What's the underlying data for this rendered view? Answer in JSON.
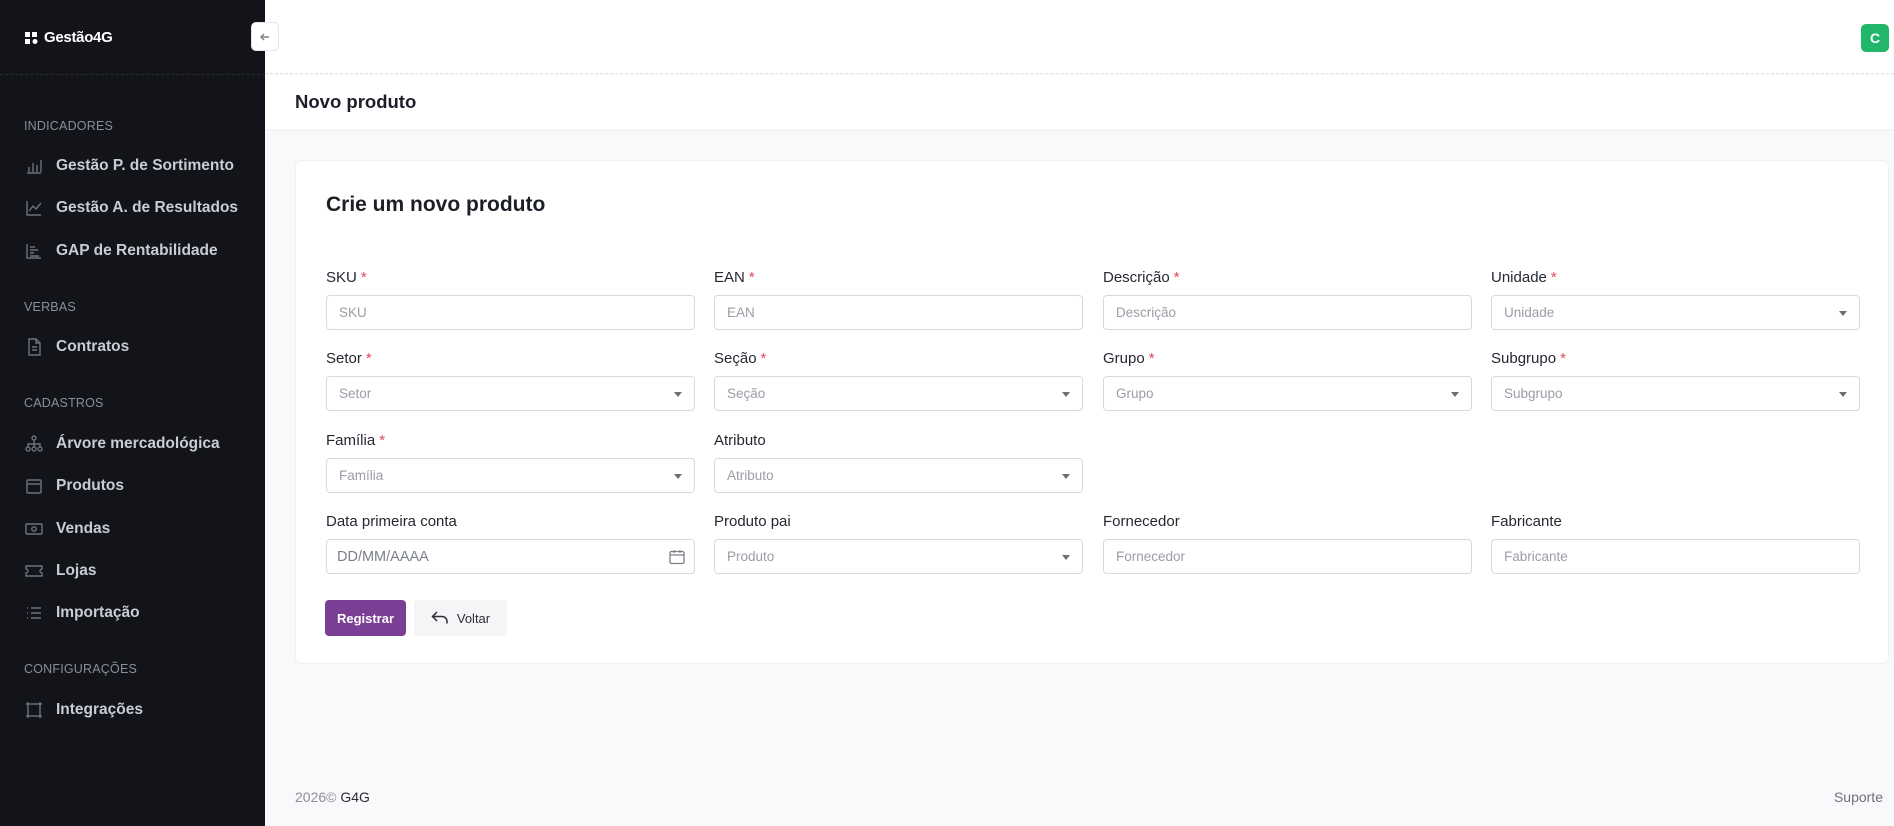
{
  "app": {
    "logo_text": "Gestão4G"
  },
  "sidebar": {
    "sections": [
      {
        "title": "INDICADORES",
        "items": [
          {
            "label": "Gestão P. de Sortimento",
            "icon": "bar-chart-icon"
          },
          {
            "label": "Gestão A. de Resultados",
            "icon": "line-chart-icon"
          },
          {
            "label": "GAP de Rentabilidade",
            "icon": "gap-chart-icon"
          }
        ]
      },
      {
        "title": "VERBAS",
        "items": [
          {
            "label": "Contratos",
            "icon": "document-icon"
          }
        ]
      },
      {
        "title": "CADASTROS",
        "items": [
          {
            "label": "Árvore mercadológica",
            "icon": "hierarchy-icon"
          },
          {
            "label": "Produtos",
            "icon": "box-icon"
          },
          {
            "label": "Vendas",
            "icon": "cash-icon"
          },
          {
            "label": "Lojas",
            "icon": "ticket-icon"
          },
          {
            "label": "Importação",
            "icon": "list-icon"
          }
        ]
      },
      {
        "title": "CONFIGURAÇÕES",
        "items": [
          {
            "label": "Integrações",
            "icon": "frame-icon"
          }
        ]
      }
    ]
  },
  "header": {
    "avatar_initial": "C"
  },
  "page": {
    "title": "Novo produto"
  },
  "form": {
    "title": "Crie um novo produto",
    "fields": {
      "sku": {
        "label": "SKU",
        "placeholder": "SKU"
      },
      "ean": {
        "label": "EAN",
        "placeholder": "EAN"
      },
      "descricao": {
        "label": "Descrição",
        "placeholder": "Descrição"
      },
      "unidade": {
        "label": "Unidade",
        "placeholder": "Unidade"
      },
      "setor": {
        "label": "Setor",
        "placeholder": "Setor"
      },
      "secao": {
        "label": "Seção",
        "placeholder": "Seção"
      },
      "grupo": {
        "label": "Grupo",
        "placeholder": "Grupo"
      },
      "subgrupo": {
        "label": "Subgrupo",
        "placeholder": "Subgrupo"
      },
      "familia": {
        "label": "Família",
        "placeholder": "Família"
      },
      "atributo": {
        "label": "Atributo",
        "placeholder": "Atributo"
      },
      "data": {
        "label": "Data primeira conta",
        "placeholder": "DD/MM/AAAA"
      },
      "produto_pai": {
        "label": "Produto pai",
        "placeholder": "Produto"
      },
      "fornecedor": {
        "label": "Fornecedor",
        "placeholder": "Fornecedor"
      },
      "fabricante": {
        "label": "Fabricante",
        "placeholder": "Fabricante"
      }
    },
    "required_mark": "*",
    "submit_label": "Registrar",
    "back_label": "Voltar"
  },
  "footer": {
    "year": "2026©",
    "brand": "G4G",
    "support": "Suporte"
  },
  "colors": {
    "primary": "#7a3f94",
    "avatar": "#22b66b",
    "sidebar_bg": "#131419",
    "required": "#e0475a"
  }
}
